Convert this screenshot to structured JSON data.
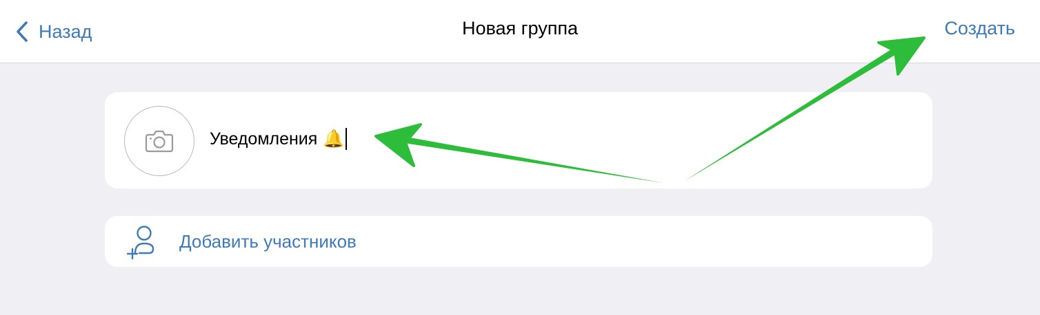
{
  "navbar": {
    "back_label": "Назад",
    "title": "Новая группа",
    "create_label": "Создать"
  },
  "group": {
    "name_value": "Уведомления",
    "name_emoji": "🔔"
  },
  "add_members": {
    "label": "Добавить участников"
  },
  "icons": {
    "back": "chevron-left-icon",
    "avatar": "camera-icon",
    "add_members": "add-person-icon"
  },
  "colors": {
    "accent": "#3f7ab8",
    "background": "#efeff4",
    "annotation_arrow": "#2ebd3a"
  }
}
